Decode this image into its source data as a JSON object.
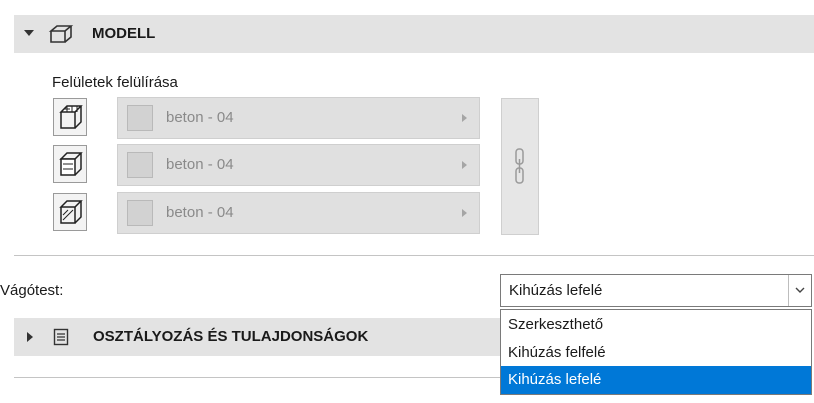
{
  "model_section": {
    "title": "MODELL",
    "expanded": true
  },
  "surface_override": {
    "label": "Felületek felülírása",
    "rows": [
      {
        "icon": "top-surface-icon",
        "material": "beton - 04"
      },
      {
        "icon": "side-surface-icon",
        "material": "beton - 04"
      },
      {
        "icon": "bottom-surface-icon",
        "material": "beton - 04"
      }
    ],
    "link_icon": "chain-link-icon"
  },
  "cutting_body": {
    "label": "Vágótest:",
    "selected": "Kihúzás lefelé",
    "options": [
      "Szerkeszthető",
      "Kihúzás felfelé",
      "Kihúzás lefelé"
    ],
    "highlighted_option": "Kihúzás lefelé"
  },
  "classification_section": {
    "title": "OSZTÁLYOZÁS ÉS TULAJDONSÁGOK",
    "expanded": false
  },
  "colors": {
    "header_bg": "#e3e3e3",
    "selection": "#0078d7",
    "disabled_text": "#8a8a8a"
  }
}
